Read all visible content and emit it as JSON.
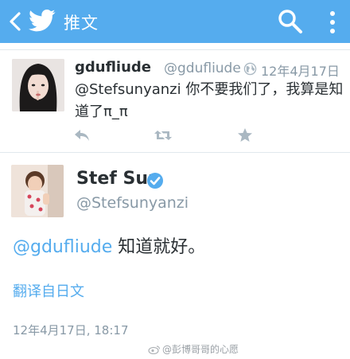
{
  "header": {
    "title": "推文",
    "background": "#55acee",
    "icons": [
      "back-arrow-icon",
      "twitter-bird-icon",
      "search-icon",
      "more-vertical-icon"
    ]
  },
  "tweets": [
    {
      "name": "gdufliude",
      "handle": "@gdufliude",
      "date": "12年4月17日",
      "text": "@Stefsunyanzi 你不要我们了，我算是知道了π_π",
      "actions": [
        "reply-icon",
        "retweet-icon",
        "favorite-icon"
      ]
    },
    {
      "name": "Stef Sun",
      "handle": "@Stefsunyanzi",
      "verified": true,
      "mention": "@gdufliude",
      "body": " 知道就好。",
      "translate_label": "翻译自日文",
      "timestamp": "12年4月17日, 18:17"
    }
  ],
  "watermark": "@彭博哥哥的心愿",
  "colors": {
    "accent": "#55acee",
    "text": "#292f33",
    "muted": "#8899a6"
  }
}
